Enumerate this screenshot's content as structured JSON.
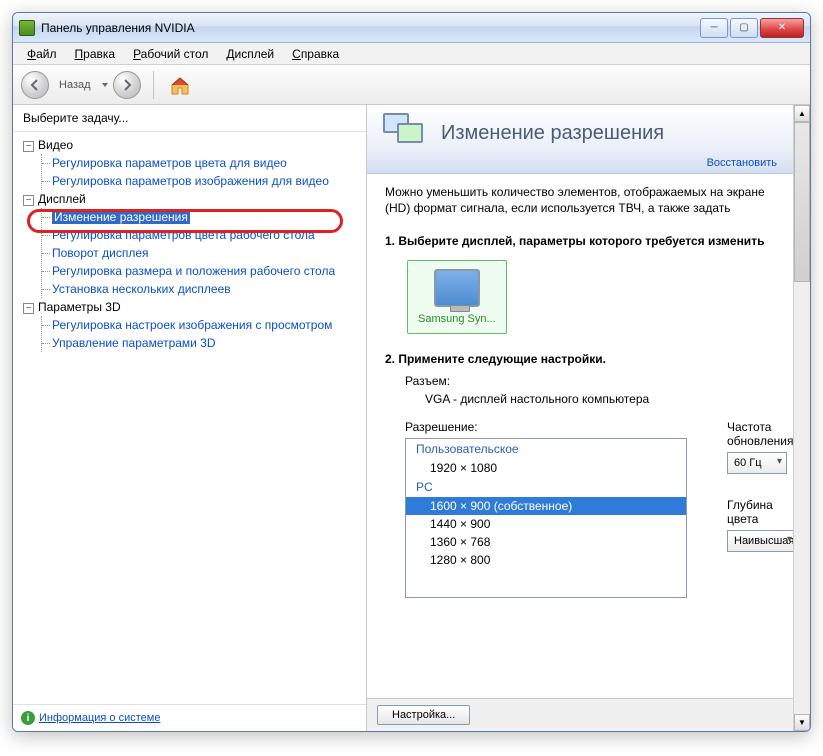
{
  "window": {
    "title": "Панель управления NVIDIA"
  },
  "menu": {
    "file": "Файл",
    "edit": "Правка",
    "desktop": "Рабочий стол",
    "display": "Дисплей",
    "help": "Справка"
  },
  "toolbar": {
    "back": "Назад"
  },
  "sidebar": {
    "chooseTask": "Выберите задачу...",
    "video": {
      "label": "Видео",
      "items": [
        "Регулировка параметров цвета для видео",
        "Регулировка параметров изображения для видео"
      ]
    },
    "display": {
      "label": "Дисплей",
      "items": [
        "Изменение разрешения",
        "Регулировка параметров цвета рабочего стола",
        "Поворот дисплея",
        "Регулировка размера и положения рабочего стола",
        "Установка нескольких дисплеев"
      ]
    },
    "params3d": {
      "label": "Параметры 3D",
      "items": [
        "Регулировка настроек изображения с просмотром",
        "Управление параметрами 3D"
      ]
    },
    "sysinfo": "Информация о системе"
  },
  "content": {
    "title": "Изменение разрешения",
    "restore": "Восстановить",
    "desc": "Можно уменьшить количество элементов, отображаемых на экране (HD) формат сигнала, если используется ТВЧ, а также задать",
    "step1": "1. Выберите дисплей, параметры которого требуется изменить",
    "displayName": "Samsung Syn...",
    "step2": "2. Примените следующие настройки.",
    "connectorLabel": "Разъем:",
    "connectorVal": "VGA - дисплей настольного компьютера",
    "resolutionLabel": "Разрешение:",
    "resGroups": {
      "custom": "Пользовательское",
      "pc": "PC"
    },
    "resOptions": [
      "1920 × 1080",
      "1600 × 900 (собственное)",
      "1440 × 900",
      "1360 × 768",
      "1280 × 800"
    ],
    "refreshLabel": "Частота обновления",
    "refreshVal": "60 Гц",
    "depthLabel": "Глубина цвета",
    "depthVal": "Наивысшая",
    "settingsBtn": "Настройка..."
  }
}
